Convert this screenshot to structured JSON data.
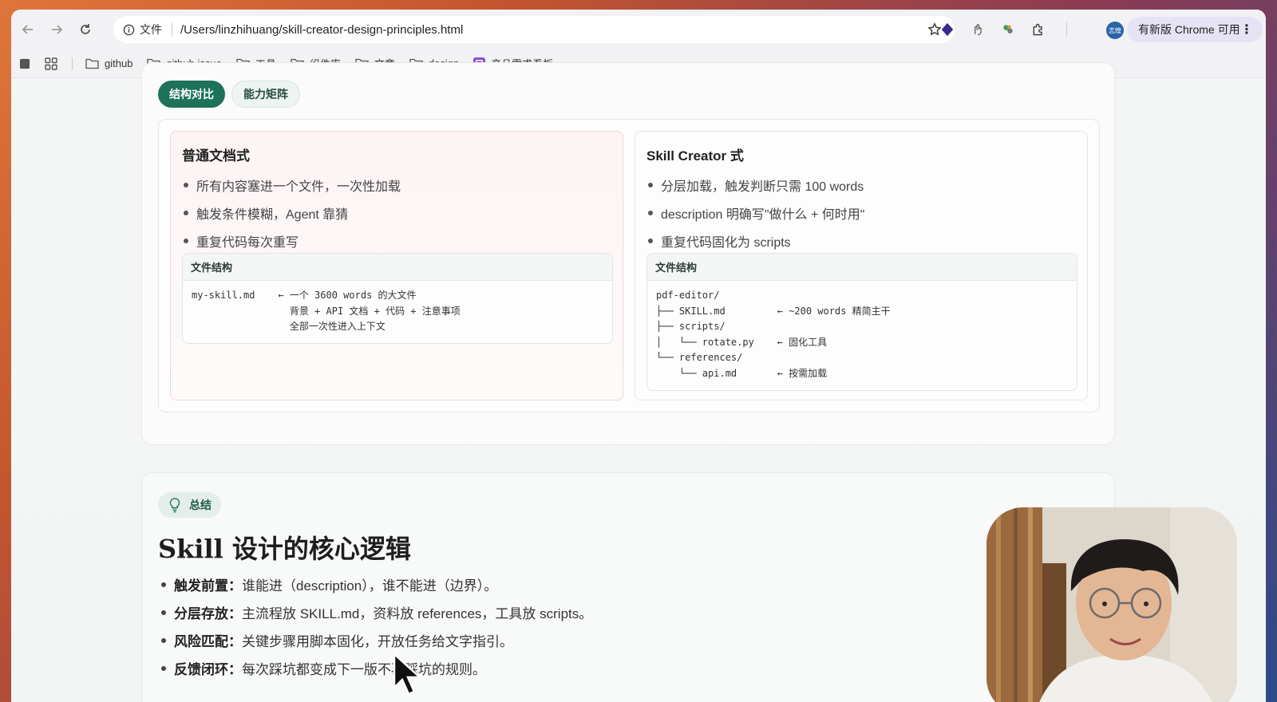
{
  "browser": {
    "address_scheme": "文件",
    "url": "/Users/linzhihuang/skill-creator-design-principles.html",
    "update_label": "有新版 Chrome 可用",
    "avatar_text": "志煌"
  },
  "bookmarks": [
    {
      "label": "github"
    },
    {
      "label": "github issue"
    },
    {
      "label": "工具"
    },
    {
      "label": "组件库"
    },
    {
      "label": "文章"
    },
    {
      "label": "design"
    },
    {
      "label": "产品需求看板"
    }
  ],
  "comparison": {
    "tabs": [
      {
        "label": "结构对比",
        "active": true
      },
      {
        "label": "能力矩阵",
        "active": false
      }
    ],
    "left": {
      "title": "普通文档式",
      "bullets": [
        "所有内容塞进一个文件，一次性加载",
        "触发条件模糊，Agent 靠猜",
        "重复代码每次重写"
      ],
      "file_heading": "文件结构",
      "file_tree": "my-skill.md    ← 一个 3600 words 的大文件\n                 背景 + API 文档 + 代码 + 注意事项\n                 全部一次性进入上下文"
    },
    "right": {
      "title": "Skill Creator 式",
      "bullets": [
        "分层加载，触发判断只需 100 words",
        "description 明确写\"做什么 + 何时用\"",
        "重复代码固化为 scripts"
      ],
      "file_heading": "文件结构",
      "file_tree": "pdf-editor/\n├── SKILL.md         ← ~200 words 精简主干\n├── scripts/\n│   └── rotate.py    ← 固化工具\n└── references/\n    └── api.md       ← 按需加载"
    }
  },
  "summary": {
    "badge": "总结",
    "title": "Skill 设计的核心逻辑",
    "items": [
      {
        "label": "触发前置：",
        "text": "谁能进（description），谁不能进（边界）。"
      },
      {
        "label": "分层存放：",
        "text": "主流程放 SKILL.md，资料放 references，工具放 scripts。"
      },
      {
        "label": "风险匹配：",
        "text": "关键步骤用脚本固化，开放任务给文字指引。"
      },
      {
        "label": "反馈闭环：",
        "text": "每次踩坑都变成下一版不再踩坑的规则。"
      }
    ]
  },
  "colors": {
    "accent": "#1d7259",
    "left_column_tint": "#fdf4f4"
  }
}
